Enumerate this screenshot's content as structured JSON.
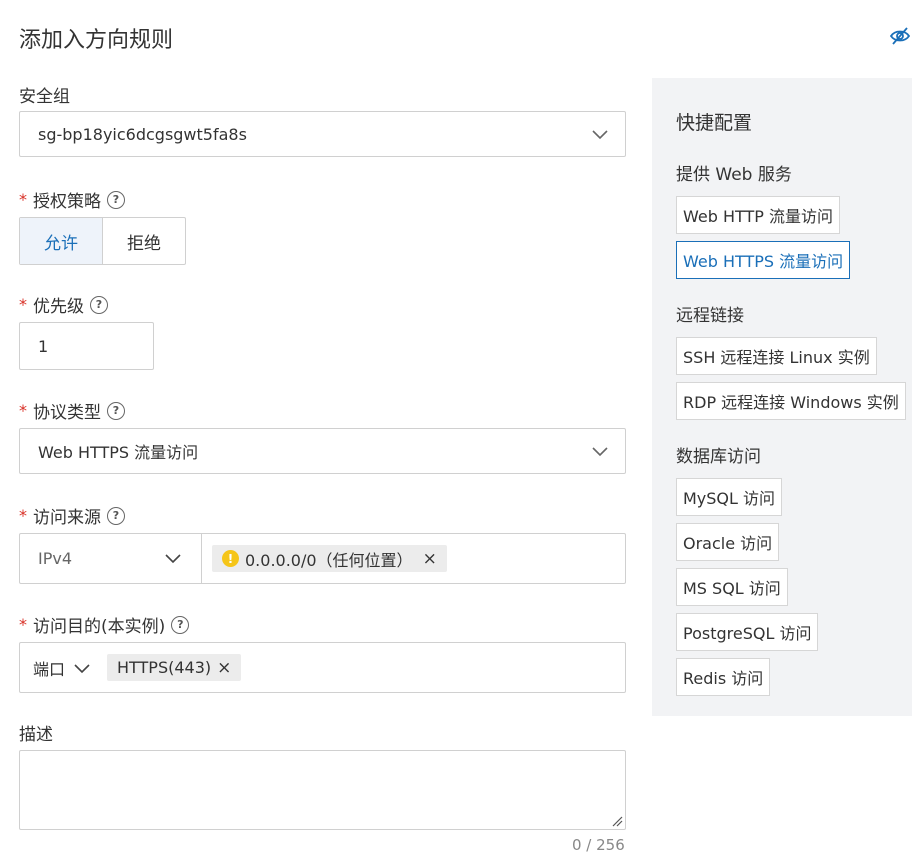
{
  "title": "添加入方向规则",
  "security_group": {
    "label": "安全组",
    "value": "sg-bp18yic6dcgsgwt5fa8s"
  },
  "auth_policy": {
    "label": "授权策略",
    "options": [
      "允许",
      "拒绝"
    ],
    "selected": "允许"
  },
  "priority": {
    "label": "优先级",
    "value": "1"
  },
  "protocol": {
    "label": "协议类型",
    "value": "Web HTTPS 流量访问"
  },
  "source": {
    "label": "访问来源",
    "ip_version": "IPv4",
    "tag": "0.0.0.0/0（任何位置）",
    "warn_symbol": "!"
  },
  "destination": {
    "label": "访问目的(本实例)",
    "type": "端口",
    "tag": "HTTPS(443)"
  },
  "description": {
    "label": "描述",
    "value": "",
    "counter": "0 / 256"
  },
  "quick_config": {
    "title": "快捷配置",
    "groups": [
      {
        "label": "提供 Web 服务",
        "items": [
          "Web HTTP 流量访问",
          "Web HTTPS 流量访问"
        ]
      },
      {
        "label": "远程链接",
        "items": [
          "SSH 远程连接 Linux 实例",
          "RDP 远程连接 Windows 实例"
        ]
      },
      {
        "label": "数据库访问",
        "items": [
          "MySQL 访问",
          "Oracle 访问",
          "MS SQL 访问",
          "PostgreSQL 访问",
          "Redis 访问"
        ]
      }
    ],
    "active_item": "Web HTTPS 流量访问"
  },
  "symbols": {
    "help": "?",
    "required": "*",
    "remove": "×"
  },
  "colors": {
    "accent": "#1a6fb8",
    "required": "#d93026",
    "warning": "#f5c518",
    "panel_bg": "#f2f3f5"
  }
}
